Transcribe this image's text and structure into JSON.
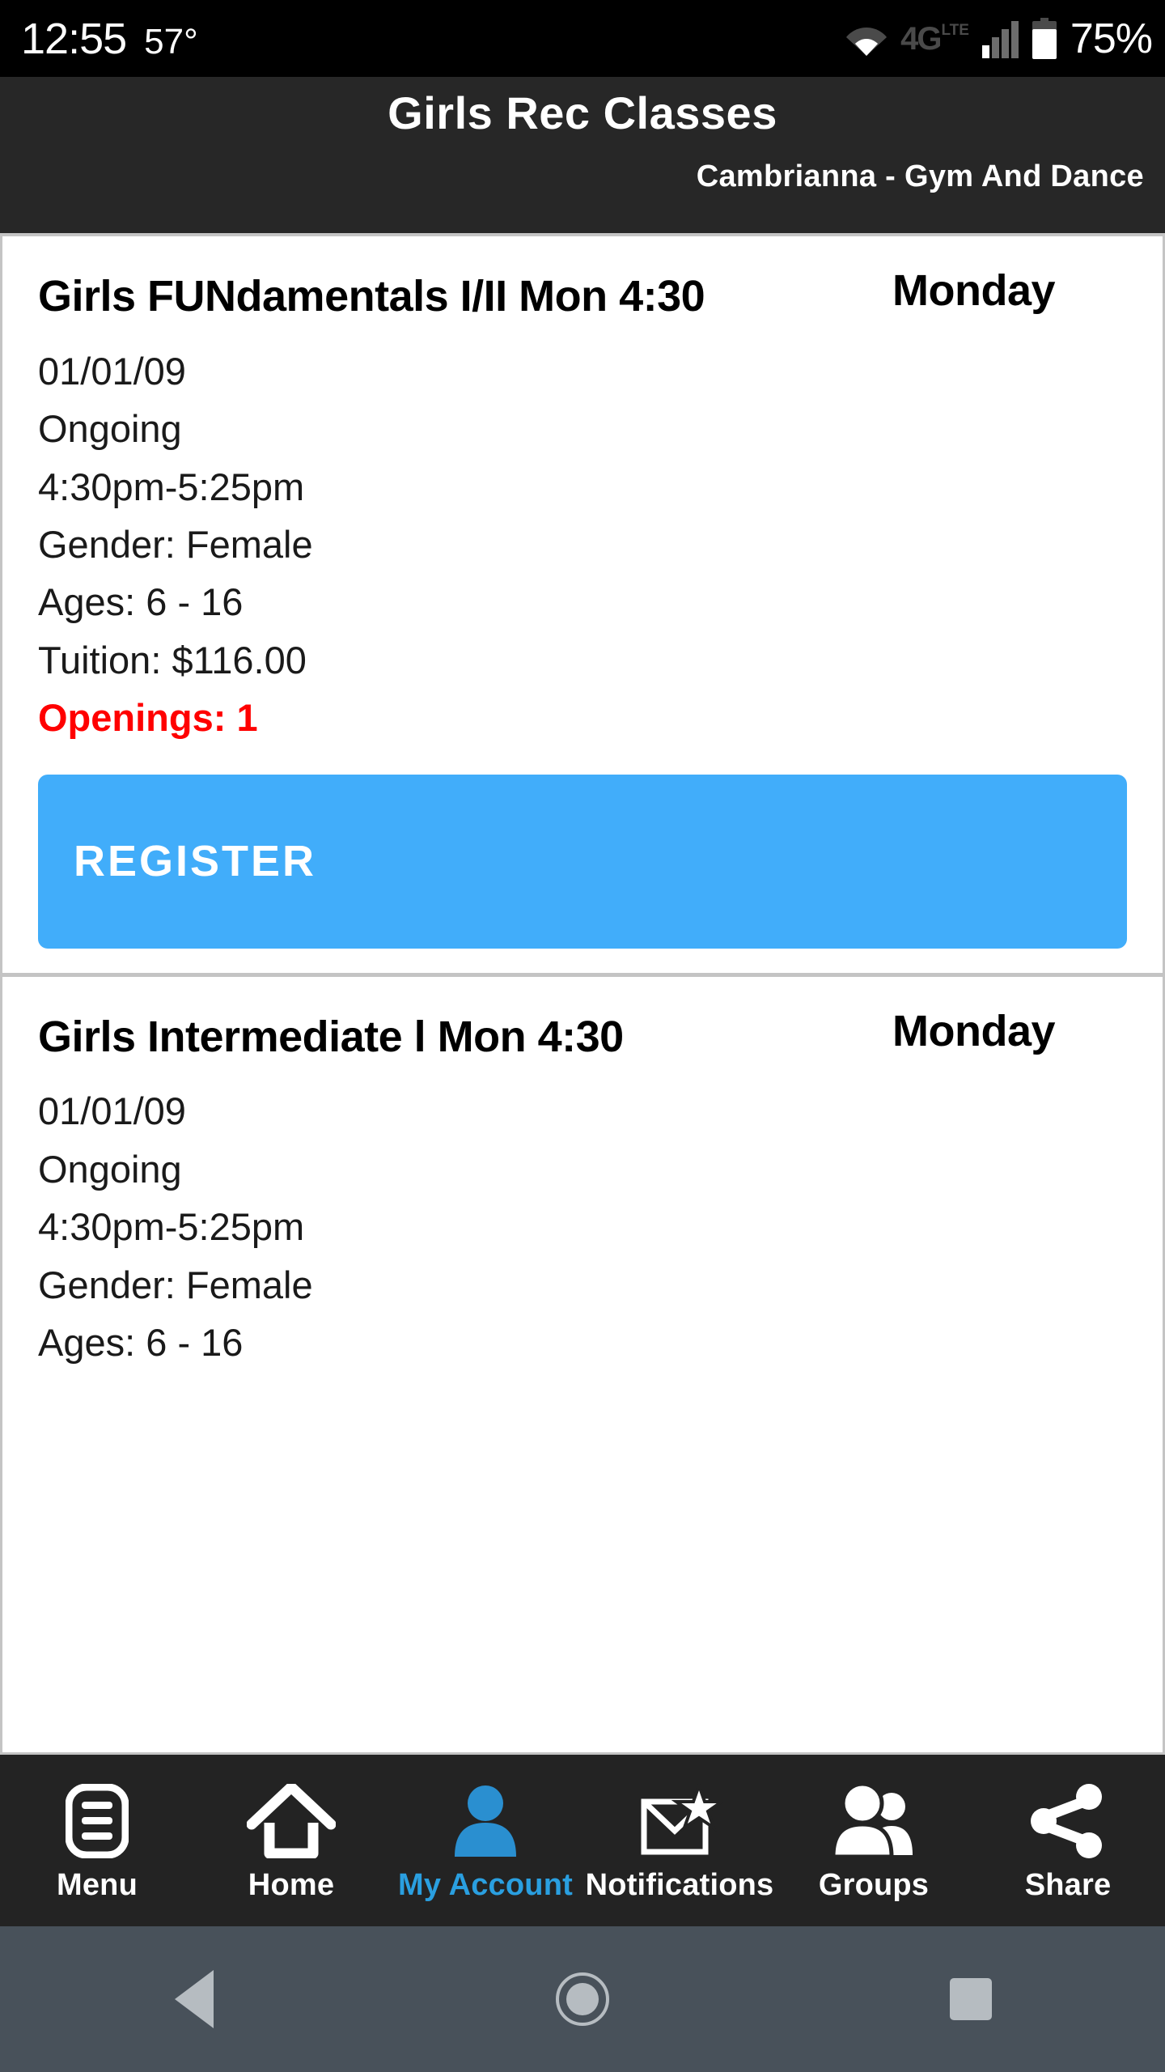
{
  "status_bar": {
    "time": "12:55",
    "temperature": "57°",
    "wifi_icon": "wifi-icon",
    "network_label": "4G",
    "network_sub": "LTE",
    "signal_icon": "signal-bars-icon",
    "battery_icon": "battery-icon",
    "battery_percent": "75%"
  },
  "header": {
    "title": "Girls Rec Classes",
    "subtitle": "Cambrianna - Gym And Dance"
  },
  "classes": [
    {
      "title": "Girls FUNdamentals I/II Mon 4:30",
      "day": "Monday",
      "start_date": "01/01/09",
      "status": "Ongoing",
      "time_range": "4:30pm-5:25pm",
      "gender": "Gender: Female",
      "ages": "Ages: 6 - 16",
      "tuition": "Tuition: $116.00",
      "openings": "Openings: 1",
      "register_label": "REGISTER"
    },
    {
      "title": "Girls Intermediate l Mon 4:30",
      "day": "Monday",
      "start_date": "01/01/09",
      "status": "Ongoing",
      "time_range": "4:30pm-5:25pm",
      "gender": "Gender: Female",
      "ages": "Ages: 6 - 16"
    }
  ],
  "tab_bar": {
    "items": [
      {
        "label": "Menu",
        "icon": "menu-list-icon",
        "active": false
      },
      {
        "label": "Home",
        "icon": "home-icon",
        "active": false
      },
      {
        "label": "My Account",
        "icon": "person-icon",
        "active": true
      },
      {
        "label": "Notifications",
        "icon": "envelope-star-icon",
        "active": false
      },
      {
        "label": "Groups",
        "icon": "people-group-icon",
        "active": false
      },
      {
        "label": "Share",
        "icon": "share-nodes-icon",
        "active": false
      }
    ]
  },
  "android_nav": {
    "back": "back-triangle-icon",
    "home": "home-circle-icon",
    "recents": "recents-square-icon"
  },
  "colors": {
    "status_bar_bg": "#000000",
    "header_bg": "#272727",
    "tab_bar_bg": "#232323",
    "accent_blue": "#41adfa",
    "active_tab_blue": "#2a9fe0",
    "openings_red": "#ff0000",
    "android_nav_bg": "#48515a",
    "divider_gray": "#c4c4c4"
  }
}
